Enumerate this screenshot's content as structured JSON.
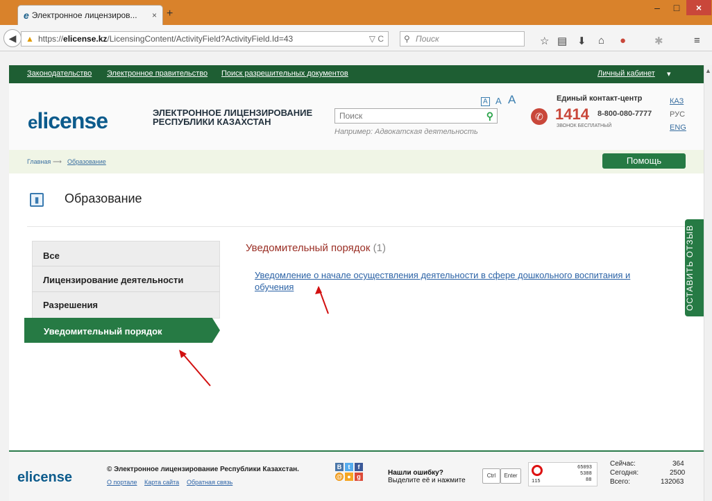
{
  "browser": {
    "tab_title": "Электронное лицензиров...",
    "tab_close": "×",
    "new_tab": "+",
    "window_min": "‒",
    "window_max": "□",
    "window_close": "×",
    "url_prefix": "https://",
    "url_domain": "elicense.kz",
    "url_path": "/LicensingContent/ActivityField?ActivityField.Id=43",
    "url_tools": "▽ C",
    "search_placeholder": "Поиск"
  },
  "site": {
    "topnav": {
      "legislation": "Законодательство",
      "egov": "Электронное правительство",
      "permits": "Поиск разрешительных документов",
      "cabinet": "Личный кабинет",
      "cabinet_arrow": "▾"
    },
    "logo_prefix": "e",
    "logo_text": "license",
    "title_line1": "ЭЛЕКТРОННОЕ ЛИЦЕНЗИРОВАНИЕ",
    "title_line2": "РЕСПУБЛИКИ КАЗАХСТАН",
    "font_sizes": [
      "A",
      "A",
      "A"
    ],
    "search_placeholder": "Поиск",
    "search_example": "Например: Адвокатская деятельность",
    "contact_center": "Единый контакт-центр",
    "contact_number": "1414",
    "toll_free": "8-800-080-7777",
    "free_label": "ЗВОНОК БЕСПЛАТНЫЙ",
    "languages": [
      "КАЗ",
      "РУС",
      "ENG"
    ]
  },
  "breadcrumb": {
    "home": "Главная",
    "arrow": "⟶",
    "current": "Образование"
  },
  "help_button": "Помощь",
  "page_title": "Образование",
  "sidebar": {
    "items": [
      {
        "label": "Все"
      },
      {
        "label": "Лицензирование деятельности"
      },
      {
        "label": "Разрешения"
      },
      {
        "label": "Уведомительный порядок"
      }
    ]
  },
  "result": {
    "heading": "Уведомительный порядок",
    "count": "(1)",
    "link_text": "Уведомление о начале осуществления деятельности в сфере дошкольного воспитания и обучения"
  },
  "feedback_tab": "ОСТАВИТЬ ОТЗЫВ",
  "footer": {
    "logo_prefix": "e",
    "logo_text": "license",
    "copyright": "© Электронное лицензирование Республики Казахстан.",
    "links": [
      "О портале",
      "Карта сайта",
      "Обратная связь"
    ],
    "error_title": "Нашли ошибку?",
    "error_text": "Выделите её и нажмите",
    "key_ctrl": "Ctrl",
    "key_enter": "Enter",
    "counter_values": [
      "65093",
      "5388",
      "88",
      "115"
    ],
    "stats": [
      {
        "label": "Сейчас:",
        "value": "364"
      },
      {
        "label": "Сегодня:",
        "value": "2500"
      },
      {
        "label": "Всего:",
        "value": "132063"
      }
    ]
  },
  "colors": {
    "brand_green": "#267a44",
    "nav_green": "#1e5e33",
    "logo_blue": "#0c5b8c",
    "accent_red": "#c9473a",
    "link_blue": "#2c63a6"
  }
}
